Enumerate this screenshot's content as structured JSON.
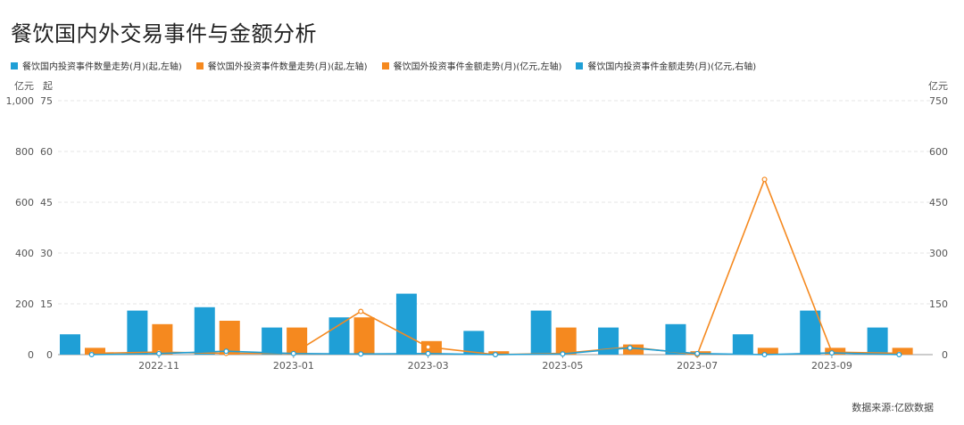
{
  "chart_data": {
    "type": "bar",
    "title": "餐饮国内外交易事件与金额分析",
    "source": "数据来源:亿欧数据",
    "categories": [
      "2022-10",
      "2022-11",
      "2022-12",
      "2023-01",
      "2023-02",
      "2023-03",
      "2023-04",
      "2023-05",
      "2023-06",
      "2023-07",
      "2023-08",
      "2023-09",
      "2023-10"
    ],
    "x_tick_labels": [
      "2022-11",
      "2023-01",
      "2023-03",
      "2023-05",
      "2023-07",
      "2023-09"
    ],
    "axes": {
      "left_outer": {
        "unit": "亿元",
        "ticks": [
          "1,000",
          "800",
          "600",
          "400",
          "200",
          "0"
        ],
        "ylim": [
          0,
          1000
        ]
      },
      "left_inner": {
        "unit": "起",
        "ticks": [
          "75",
          "60",
          "45",
          "30",
          "15",
          "0"
        ],
        "ylim": [
          0,
          75
        ]
      },
      "right": {
        "unit": "亿元",
        "ticks": [
          "750",
          "600",
          "450",
          "300",
          "150",
          "0"
        ],
        "ylim": [
          0,
          750
        ]
      }
    },
    "series": [
      {
        "name": "餐饮国内投资事件数量走势(月)(起,左轴)",
        "type": "bar",
        "axis": "left_inner",
        "color": "#1f9fd6",
        "values": [
          6,
          13,
          14,
          8,
          11,
          18,
          7,
          13,
          8,
          9,
          6,
          13,
          8
        ]
      },
      {
        "name": "餐饮国外投资事件数量走势(月)(起,左轴)",
        "type": "bar",
        "axis": "left_inner",
        "color": "#f5891f",
        "values": [
          2,
          9,
          10,
          8,
          11,
          4,
          1,
          8,
          3,
          1,
          2,
          2,
          2
        ]
      },
      {
        "name": "餐饮国外投资事件金额走势(月)(亿元,左轴)",
        "type": "line",
        "axis": "left_outer",
        "color": "#f5891f",
        "values": [
          5,
          10,
          5,
          5,
          170,
          30,
          0,
          5,
          30,
          0,
          690,
          10,
          5
        ]
      },
      {
        "name": "餐饮国内投资事件金额走势(月)(亿元,右轴)",
        "type": "line",
        "axis": "right",
        "color": "#1f9fd6",
        "values": [
          0,
          3,
          10,
          3,
          2,
          3,
          0,
          2,
          20,
          3,
          0,
          5,
          0
        ]
      }
    ],
    "grid": true,
    "legend": "top-left"
  }
}
